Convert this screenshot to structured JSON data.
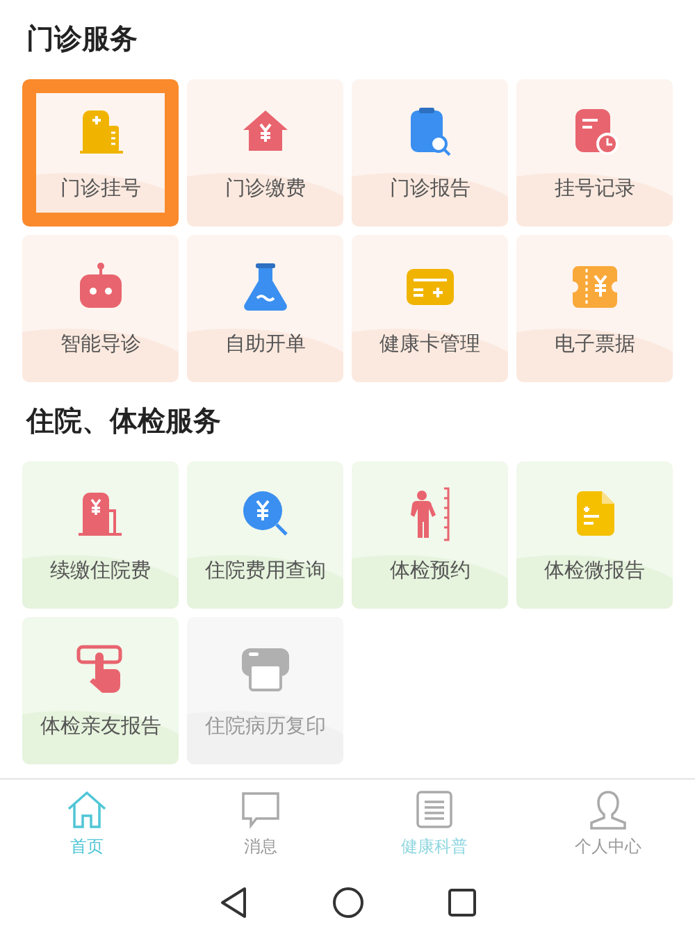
{
  "sections": [
    {
      "title": "门诊服务",
      "kind": "warm",
      "tiles": [
        {
          "label": "门诊挂号",
          "kind": "hospital",
          "color": "#f0b400",
          "highlighted": true,
          "disabled": false
        },
        {
          "label": "门诊缴费",
          "kind": "house-yen",
          "color": "#e8646e",
          "highlighted": false,
          "disabled": false
        },
        {
          "label": "门诊报告",
          "kind": "clipboard-search",
          "color": "#3a8ff0",
          "highlighted": false,
          "disabled": false
        },
        {
          "label": "挂号记录",
          "kind": "record-clock",
          "color": "#e8646e",
          "highlighted": false,
          "disabled": false
        },
        {
          "label": "智能导诊",
          "kind": "robot",
          "color": "#e8646e",
          "highlighted": false,
          "disabled": false
        },
        {
          "label": "自助开单",
          "kind": "flask",
          "color": "#3a8ff0",
          "highlighted": false,
          "disabled": false
        },
        {
          "label": "健康卡管理",
          "kind": "card",
          "color": "#f0b400",
          "highlighted": false,
          "disabled": false
        },
        {
          "label": "电子票据",
          "kind": "ticket",
          "color": "#f9a93a",
          "highlighted": false,
          "disabled": false
        }
      ]
    },
    {
      "title": "住院、体检服务",
      "kind": "green",
      "tiles": [
        {
          "label": "续缴住院费",
          "kind": "pump-yen",
          "color": "#e8646e",
          "highlighted": false,
          "disabled": false
        },
        {
          "label": "住院费用查询",
          "kind": "yen-search",
          "color": "#3a8ff0",
          "highlighted": false,
          "disabled": false
        },
        {
          "label": "体检预约",
          "kind": "person-ruler",
          "color": "#e8646e",
          "highlighted": false,
          "disabled": false
        },
        {
          "label": "体检微报告",
          "kind": "document",
          "color": "#f5c000",
          "highlighted": false,
          "disabled": false
        },
        {
          "label": "体检亲友报告",
          "kind": "tap",
          "color": "#e8646e",
          "highlighted": false,
          "disabled": false
        },
        {
          "label": "住院病历复印",
          "kind": "printer",
          "color": "#b0b0b0",
          "highlighted": false,
          "disabled": true
        }
      ]
    }
  ],
  "tabs": [
    {
      "label": "首页",
      "kind": "home",
      "selected": true,
      "accent": false
    },
    {
      "label": "消息",
      "kind": "chat",
      "selected": false,
      "accent": false
    },
    {
      "label": "健康科普",
      "kind": "article",
      "selected": false,
      "accent": true
    },
    {
      "label": "个人中心",
      "kind": "person",
      "selected": false,
      "accent": false
    }
  ]
}
